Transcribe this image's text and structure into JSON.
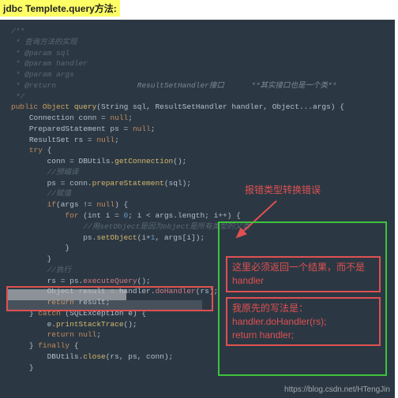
{
  "title": "jdbc Templete.query方法:",
  "code": {
    "block_open": "/**",
    "cmt1": " * 查询方法的实现",
    "cmt2": " * @param sql",
    "cmt3": " * @param handler",
    "cmt4": " * @param args",
    "cmt5a": " * @return",
    "cmt5b": "ResultSetHandler接口",
    "cmt5c": "**其实接口也是一个类**",
    "block_close": " */",
    "sig_public": "public",
    "sig_ret": "Object",
    "sig_name": "query",
    "sig_params": "(String sql, ResultSetHandler handler, Object...args) {",
    "decl1a": "Connection conn = ",
    "decl1b": "null",
    "decl2a": "PreparedStatement ps = ",
    "decl3a": "ResultSet rs = ",
    "try": "try",
    "brace": " {",
    "close_brace": "}",
    "getconn_a": "conn = DBUtils.",
    "getconn_b": "getConnection",
    "getconn_c": "();",
    "cmt_prep": "//预编译",
    "prep_a": "ps = conn.",
    "prep_b": "prepareStatement",
    "prep_c": "(sql);",
    "cmt_assign": "//赋值",
    "if_a": "if",
    "if_b": "(args != ",
    "if_c": ") {",
    "for_a": "for",
    "for_b": " (int i = ",
    "num0": "0",
    "for_c": "; i < args.length; i++) {",
    "cmt_setobj": "//用setObject是因为object是所有类型的父类",
    "setobj_a": "ps.",
    "setobj_b": "setObject",
    "setobj_c": "(i+",
    "num1": "1",
    "setobj_d": ", args[i]);",
    "cmt_exec": "//执行",
    "exec_a": "rs = ps.",
    "exec_b": "executeQuery",
    "exec_c": "();",
    "doh_a": "Object result = handler.",
    "doh_b": "doHandler",
    "doh_c": "(rs);",
    "return": "return",
    "ret_result": " result;",
    "catch_a": "catch",
    "catch_b": " (SQLException e) {",
    "pst_a": "e.",
    "pst_b": "printStackTrace",
    "pst_c": "();",
    "retnull_a": "return ",
    "retnull_b": "null",
    "finally": "finally",
    "close_a": "DBUtils.",
    "close_b": "close",
    "close_c": "(rs, ps, conn);"
  },
  "annotations": {
    "error_label": "报错类型转换错误",
    "box1_l1": "这里必须返回一个结果，而不是",
    "box1_l2": "handler",
    "box2_l1": "我原先的写法是：",
    "box2_l2": "handler.doHandler(rs);",
    "box2_l3": "return handler;"
  },
  "watermark": "https://blog.csdn.net/HTengJin"
}
